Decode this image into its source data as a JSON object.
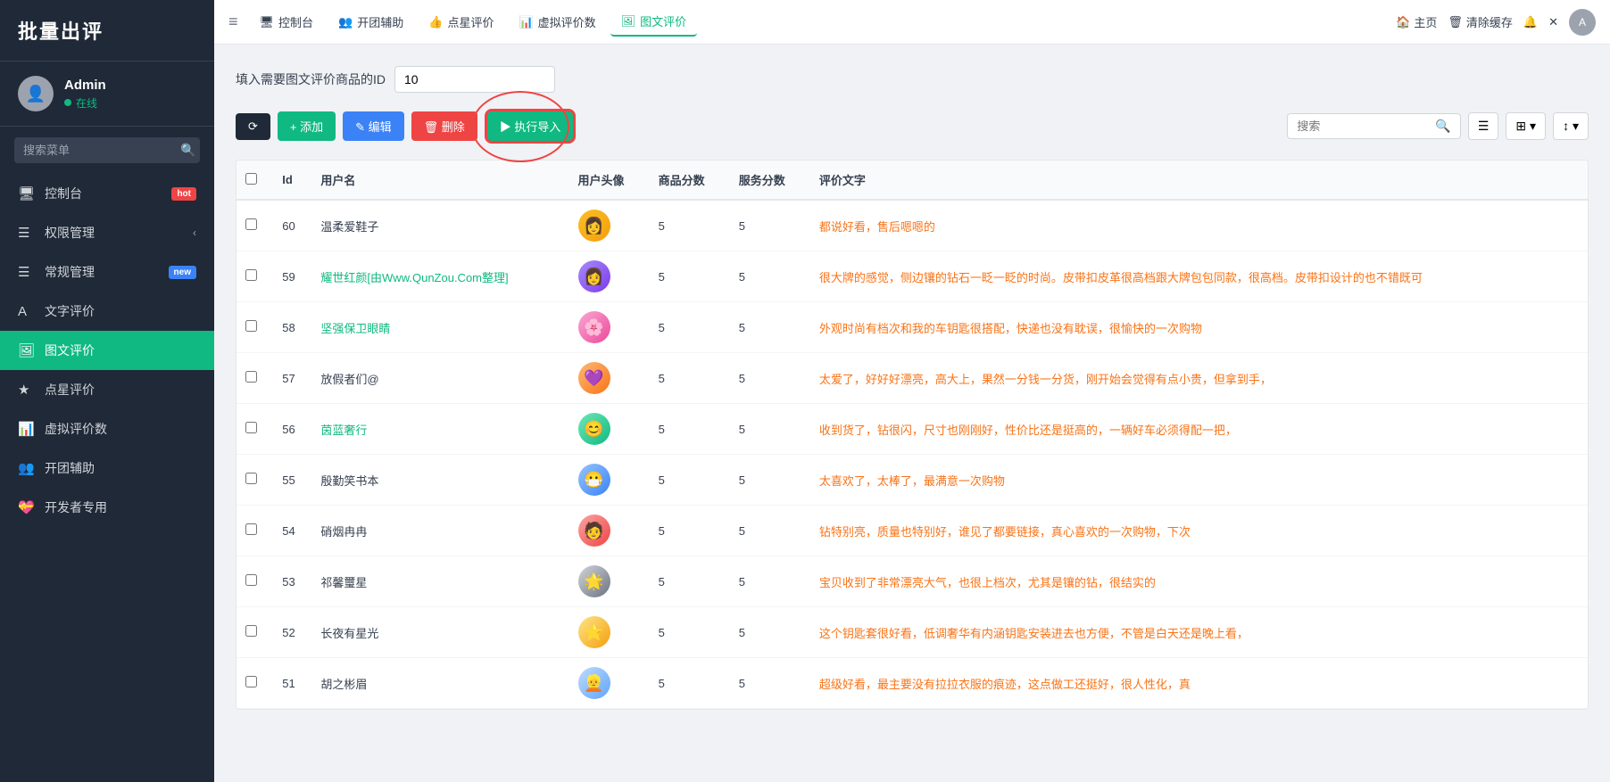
{
  "app": {
    "title": "批量出评"
  },
  "sidebar": {
    "user": {
      "name": "Admin",
      "status": "在线"
    },
    "search_placeholder": "搜索菜单",
    "items": [
      {
        "id": "dashboard",
        "label": "控制台",
        "icon": "🖥",
        "badge": "hot",
        "badge_text": "hot"
      },
      {
        "id": "permissions",
        "label": "权限管理",
        "icon": "☰",
        "badge": "",
        "badge_text": "",
        "arrow": "‹"
      },
      {
        "id": "general",
        "label": "常规管理",
        "icon": "☰",
        "badge": "new",
        "badge_text": "new"
      },
      {
        "id": "text-review",
        "label": "文字评价",
        "icon": "A",
        "badge": "",
        "badge_text": ""
      },
      {
        "id": "image-review",
        "label": "图文评价",
        "icon": "🖼",
        "badge": "",
        "badge_text": "",
        "active": true
      },
      {
        "id": "star-review",
        "label": "点星评价",
        "icon": "★",
        "badge": "",
        "badge_text": ""
      },
      {
        "id": "virtual-review",
        "label": "虚拟评价数",
        "icon": "📊",
        "badge": "",
        "badge_text": ""
      },
      {
        "id": "group-helper",
        "label": "开团辅助",
        "icon": "👥",
        "badge": "",
        "badge_text": ""
      },
      {
        "id": "developer",
        "label": "开发者专用",
        "icon": "💝",
        "badge": "",
        "badge_text": ""
      }
    ]
  },
  "topbar": {
    "menu_toggle": "≡",
    "nav_items": [
      {
        "id": "dashboard",
        "label": "控制台",
        "icon": "🖥"
      },
      {
        "id": "group-helper",
        "label": "开团辅助",
        "icon": "👥"
      },
      {
        "id": "star-review",
        "label": "点星评价",
        "icon": "👍"
      },
      {
        "id": "virtual-review",
        "label": "虚拟评价数",
        "icon": "📊"
      },
      {
        "id": "image-review",
        "label": "图文评价",
        "icon": "🖼",
        "active": true
      }
    ],
    "right": {
      "home": "主页",
      "clear_cache": "清除缓存",
      "user_initial": "A"
    }
  },
  "main": {
    "product_id_label": "填入需要图文评价商品的ID",
    "product_id_value": "10",
    "buttons": {
      "refresh": "⟳",
      "add": "+ 添加",
      "edit": "✎ 编辑",
      "delete": "🗑 删除",
      "import": "▶ 执行导入"
    },
    "search_placeholder": "搜索",
    "table": {
      "columns": [
        "Id",
        "用户名",
        "用户头像",
        "商品分数",
        "服务分数",
        "评价文字"
      ],
      "rows": [
        {
          "id": 60,
          "username": "温柔爱鞋子",
          "avatar": "1",
          "product_score": 5,
          "service_score": 5,
          "review": "都说好看，售后嗯嗯的",
          "link": false
        },
        {
          "id": 59,
          "username": "耀世红颜[由Www.QunZou.Com整理]",
          "avatar": "2",
          "product_score": 5,
          "service_score": 5,
          "review": "很大牌的感觉，侧边镶的钻石一眨一眨的时尚。皮带扣皮革很高档跟大牌包包同款，很高档。皮带扣设计的也不错既可",
          "link": true
        },
        {
          "id": 58,
          "username": "坚强保卫眼睛",
          "avatar": "3",
          "product_score": 5,
          "service_score": 5,
          "review": "外观时尚有档次和我的车钥匙很搭配，快递也没有耽误，很愉快的一次购物",
          "link": true
        },
        {
          "id": 57,
          "username": "放假者们@",
          "avatar": "4",
          "product_score": 5,
          "service_score": 5,
          "review": "太爱了，好好好漂亮，高大上，果然一分钱一分货，刚开始会觉得有点小贵，但拿到手，",
          "link": false
        },
        {
          "id": 56,
          "username": "茵蓝奢行",
          "avatar": "5",
          "product_score": 5,
          "service_score": 5,
          "review": "收到货了，钻很闪，尺寸也刚刚好，性价比还是挺高的，一辆好车必须得配一把，",
          "link": true
        },
        {
          "id": 55,
          "username": "殷勤笑书本",
          "avatar": "6",
          "product_score": 5,
          "service_score": 5,
          "review": "太喜欢了，太棒了，最满意一次购物",
          "link": false
        },
        {
          "id": 54,
          "username": "硝烟冉冉",
          "avatar": "7",
          "product_score": 5,
          "service_score": 5,
          "review": "钻特别亮，质量也特别好，谁见了都要链接，真心喜欢的一次购物，下次",
          "link": false
        },
        {
          "id": 53,
          "username": "祁馨璽星",
          "avatar": "8",
          "product_score": 5,
          "service_score": 5,
          "review": "宝贝收到了非常漂亮大气，也很上档次，尤其是镶的钻，很结实的",
          "link": false
        },
        {
          "id": 52,
          "username": "长夜有星光",
          "avatar": "9",
          "product_score": 5,
          "service_score": 5,
          "review": "这个钥匙套很好看，低调奢华有内涵钥匙安装进去也方便，不管是白天还是晚上看，",
          "link": false
        },
        {
          "id": 51,
          "username": "胡之彬眉",
          "avatar": "10",
          "product_score": 5,
          "service_score": 5,
          "review": "超级好看，最主要没有拉拉衣服的痕迹，这点做工还挺好，很人性化，真",
          "link": false
        }
      ]
    }
  }
}
